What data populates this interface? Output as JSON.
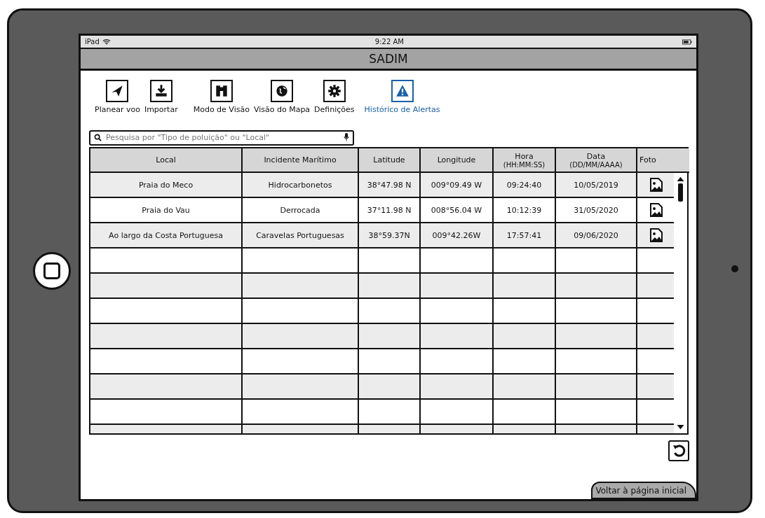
{
  "status_bar": {
    "device": "iPad",
    "time": "9:22 AM"
  },
  "title": "SADIM",
  "toolbar": [
    {
      "label": "Planear voo",
      "kind": "plane",
      "selected": false
    },
    {
      "label": "Importar",
      "kind": "download",
      "selected": false
    },
    {
      "label": "Modo de Visão",
      "kind": "binoculars",
      "selected": false
    },
    {
      "label": "Visão do Mapa",
      "kind": "globe",
      "selected": false
    },
    {
      "label": "Definições",
      "kind": "gear",
      "selected": false
    },
    {
      "label": "Histórico de Alertas",
      "kind": "warning",
      "selected": true
    }
  ],
  "search": {
    "placeholder": "Pesquisa por \"Tipo de poluição\" ou \"Local\""
  },
  "table": {
    "columns": [
      {
        "label": "Local"
      },
      {
        "label": "Incidente Marítimo"
      },
      {
        "label": "Latitude"
      },
      {
        "label": "Longitude"
      },
      {
        "label": "Hora",
        "sublabel": "(HH:MM:SS)"
      },
      {
        "label": "Data",
        "sublabel": "(DD/MM/AAAA)"
      },
      {
        "label": "Foto"
      }
    ],
    "rows": [
      {
        "cells": [
          "Praia do Meco",
          "Hidrocarbonetos",
          "38°47.98 N",
          "009°09.49 W",
          "09:24:40",
          "10/05/2019"
        ]
      },
      {
        "cells": [
          "Praia do Vau",
          "Derrocada",
          "37°11.98 N",
          "008°56.04 W",
          "10:12:39",
          "31/05/2020"
        ]
      },
      {
        "cells": [
          "Ao largo da Costa Portuguesa",
          "Caravelas Portuguesas",
          "38°59.37N",
          "009°42.26W",
          "17:57:41",
          "09/06/2020"
        ]
      }
    ]
  },
  "home_button": {
    "label": "Voltar à página inicial"
  }
}
